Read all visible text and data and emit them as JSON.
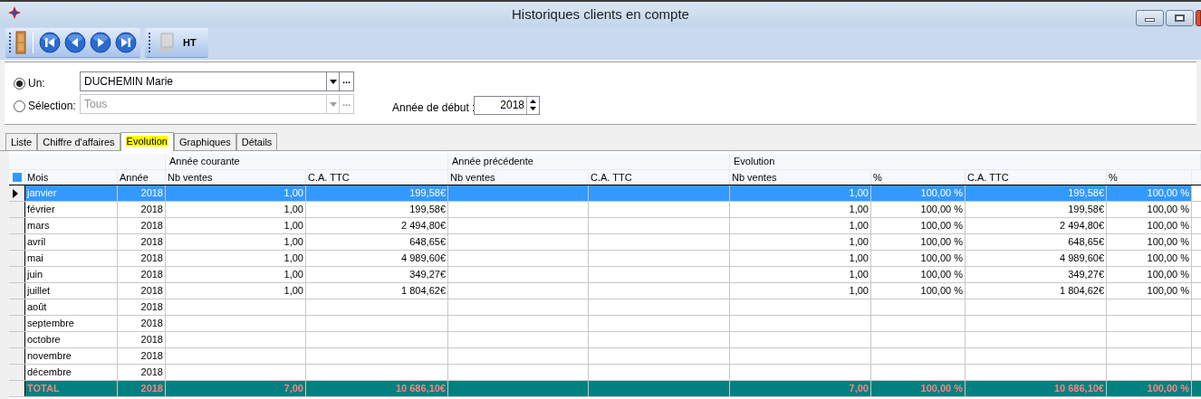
{
  "window": {
    "title": "Historiques clients en compte"
  },
  "toolbar": {
    "ht_label": "HT"
  },
  "filter": {
    "options": [
      {
        "label": "Un:",
        "selected": true,
        "value": "DUCHEMIN Marie",
        "disabled": false
      },
      {
        "label": "Sélection:",
        "selected": false,
        "value": "Tous",
        "disabled": true
      }
    ],
    "more_label": "...",
    "start_year_label": "Année de début :",
    "start_year": "2018"
  },
  "tabs": [
    {
      "label": "Liste",
      "selected": false
    },
    {
      "label": "Chiffre d'affaires",
      "selected": false
    },
    {
      "label": "Evolution",
      "selected": true
    },
    {
      "label": "Graphiques",
      "selected": false
    },
    {
      "label": "Détails",
      "selected": false
    }
  ],
  "grid": {
    "column_groups": [
      "Année courante",
      "Année précédente",
      "Evolution"
    ],
    "columns": [
      "Mois",
      "Année",
      "Nb ventes",
      "C.A. TTC",
      "Nb ventes",
      "C.A. TTC",
      "Nb ventes",
      "%",
      "C.A. TTC",
      "%"
    ],
    "rows": [
      {
        "selected": true,
        "cells": [
          "janvier",
          "2018",
          "1,00",
          "199,58€",
          null,
          null,
          "1,00",
          "100,00 %",
          "199,58€",
          "100,00 %"
        ]
      },
      {
        "selected": false,
        "cells": [
          "février",
          "2018",
          "1,00",
          "199,58€",
          null,
          null,
          "1,00",
          "100,00 %",
          "199,58€",
          "100,00 %"
        ]
      },
      {
        "selected": false,
        "cells": [
          "mars",
          "2018",
          "1,00",
          "2 494,80€",
          null,
          null,
          "1,00",
          "100,00 %",
          "2 494,80€",
          "100,00 %"
        ]
      },
      {
        "selected": false,
        "cells": [
          "avril",
          "2018",
          "1,00",
          "648,65€",
          null,
          null,
          "1,00",
          "100,00 %",
          "648,65€",
          "100,00 %"
        ]
      },
      {
        "selected": false,
        "cells": [
          "mai",
          "2018",
          "1,00",
          "4 989,60€",
          null,
          null,
          "1,00",
          "100,00 %",
          "4 989,60€",
          "100,00 %"
        ]
      },
      {
        "selected": false,
        "cells": [
          "juin",
          "2018",
          "1,00",
          "349,27€",
          null,
          null,
          "1,00",
          "100,00 %",
          "349,27€",
          "100,00 %"
        ]
      },
      {
        "selected": false,
        "cells": [
          "juillet",
          "2018",
          "1,00",
          "1 804,62€",
          null,
          null,
          "1,00",
          "100,00 %",
          "1 804,62€",
          "100,00 %"
        ]
      },
      {
        "selected": false,
        "cells": [
          "août",
          "2018",
          null,
          null,
          null,
          null,
          null,
          null,
          null,
          null
        ]
      },
      {
        "selected": false,
        "cells": [
          "septembre",
          "2018",
          null,
          null,
          null,
          null,
          null,
          null,
          null,
          null
        ]
      },
      {
        "selected": false,
        "cells": [
          "octobre",
          "2018",
          null,
          null,
          null,
          null,
          null,
          null,
          null,
          null
        ]
      },
      {
        "selected": false,
        "cells": [
          "novembre",
          "2018",
          null,
          null,
          null,
          null,
          null,
          null,
          null,
          null
        ]
      },
      {
        "selected": false,
        "cells": [
          "décembre",
          "2018",
          null,
          null,
          null,
          null,
          null,
          null,
          null,
          null
        ]
      }
    ],
    "total": {
      "mois": "TOTAL",
      "annee": "2018",
      "nb_ventes": "7,00",
      "ca_ttc": "10 686,10€",
      "evolution_nb_ventes": "7,00",
      "evolution_nb_pct": "100,00 %",
      "evolution_ca_ttc": "10 686,10€",
      "evolution_ca_pct": "100,00 %"
    }
  }
}
